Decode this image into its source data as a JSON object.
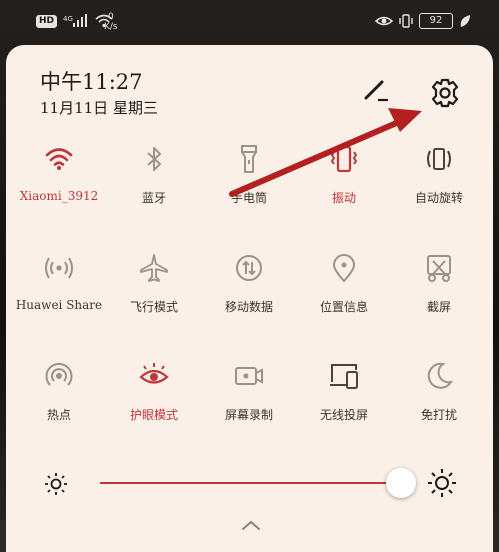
{
  "status_bar": {
    "hd": "HD",
    "network": "4G",
    "speed_value": "0",
    "speed_unit": "K/s",
    "battery": "92"
  },
  "header": {
    "time": "中午11:27",
    "date": "11月11日 星期三"
  },
  "tiles": [
    {
      "label": "Xiaomi_3912",
      "icon": "wifi-icon",
      "active": true
    },
    {
      "label": "蓝牙",
      "icon": "bluetooth-icon",
      "active": false
    },
    {
      "label": "手电筒",
      "icon": "flashlight-icon",
      "active": false
    },
    {
      "label": "振动",
      "icon": "vibrate-icon",
      "active": true
    },
    {
      "label": "自动旋转",
      "icon": "auto-rotate-icon",
      "active": false
    },
    {
      "label": "Huawei Share",
      "icon": "huawei-share-icon",
      "active": false
    },
    {
      "label": "飞行模式",
      "icon": "airplane-icon",
      "active": false
    },
    {
      "label": "移动数据",
      "icon": "mobile-data-icon",
      "active": false
    },
    {
      "label": "位置信息",
      "icon": "location-icon",
      "active": false
    },
    {
      "label": "截屏",
      "icon": "screenshot-icon",
      "active": false
    },
    {
      "label": "热点",
      "icon": "hotspot-icon",
      "active": false
    },
    {
      "label": "护眼模式",
      "icon": "eye-comfort-icon",
      "active": true
    },
    {
      "label": "屏幕录制",
      "icon": "screen-record-icon",
      "active": false
    },
    {
      "label": "无线投屏",
      "icon": "wireless-projection-icon",
      "active": false
    },
    {
      "label": "免打扰",
      "icon": "do-not-disturb-icon",
      "active": false
    }
  ],
  "brightness": {
    "level": 0.95
  },
  "colors": {
    "accent": "#c0353a",
    "panel": "#fbf0e8",
    "icon_gray": "#9a928c",
    "arrow": "#b3201f"
  }
}
